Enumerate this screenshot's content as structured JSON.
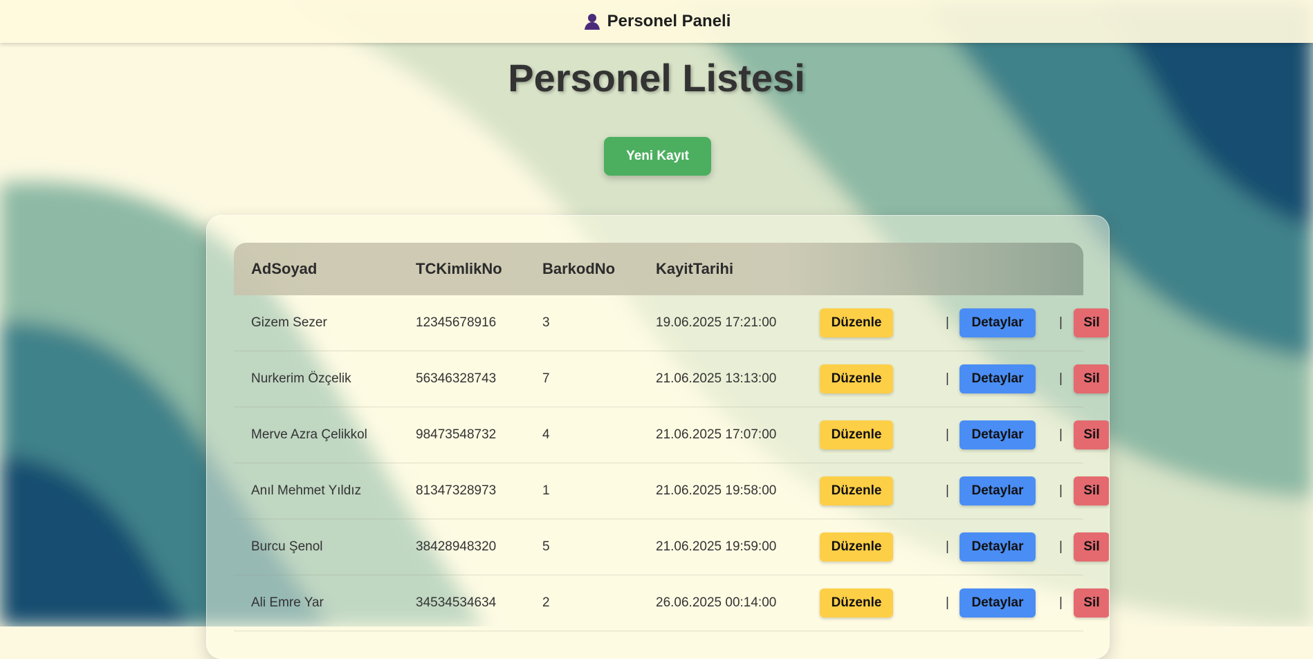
{
  "app": {
    "brand_icon": "user-icon",
    "brand_title": "Personel Paneli"
  },
  "main": {
    "title": "Personel Listesi",
    "new_button_label": "Yeni Kayıt"
  },
  "table": {
    "headers": [
      "AdSoyad",
      "TCKimlikNo",
      "BarkodNo",
      "KayitTarihi"
    ],
    "actions": {
      "edit": "Düzenle",
      "details": "Detaylar",
      "delete": "Sil",
      "separator": "|"
    },
    "rows": [
      {
        "name": "Gizem Sezer",
        "tc": "12345678916",
        "barcode": "3",
        "date": "19.06.2025 17:21:00"
      },
      {
        "name": "Nurkerim Özçelik",
        "tc": "56346328743",
        "barcode": "7",
        "date": "21.06.2025 13:13:00"
      },
      {
        "name": "Merve Azra Çelikkol",
        "tc": "98473548732",
        "barcode": "4",
        "date": "21.06.2025 17:07:00"
      },
      {
        "name": "Anıl Mehmet Yıldız",
        "tc": "81347328973",
        "barcode": "1",
        "date": "21.06.2025 19:58:00"
      },
      {
        "name": "Burcu Şenol",
        "tc": "38428948320",
        "barcode": "5",
        "date": "21.06.2025 19:59:00"
      },
      {
        "name": "Ali Emre Yar",
        "tc": "34534534634",
        "barcode": "2",
        "date": "26.06.2025 00:14:00"
      }
    ]
  },
  "colors": {
    "background": "#fdf9e1",
    "button_new": "#4caf5f",
    "button_edit": "#fdcf47",
    "button_details": "#4a8df5",
    "button_delete": "#e46a6f"
  }
}
